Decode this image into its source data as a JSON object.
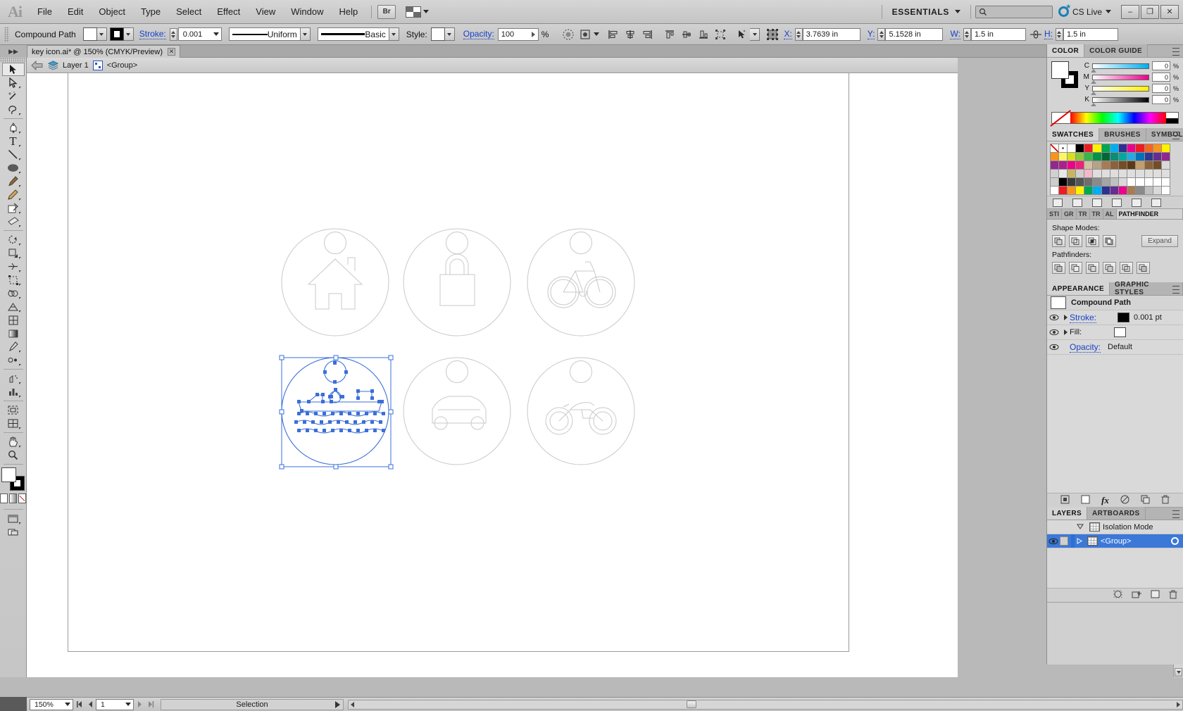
{
  "app": {
    "name": "Adobe Illustrator",
    "logo": "Ai"
  },
  "menubar": {
    "items": [
      "File",
      "Edit",
      "Object",
      "Type",
      "Select",
      "Effect",
      "View",
      "Window",
      "Help"
    ],
    "bridge_label": "Br",
    "workspace": "ESSENTIALS",
    "search_placeholder": "",
    "cslive": "CS Live",
    "window_buttons": [
      "–",
      "❐",
      "✕"
    ]
  },
  "controlbar": {
    "object_label": "Compound Path",
    "stroke_label": "Stroke:",
    "stroke_weight": "0.001",
    "profile": "Uniform",
    "brush": "Basic",
    "style_label": "Style:",
    "opacity_label": "Opacity:",
    "opacity_value": "100",
    "percent": "%",
    "x_label": "X:",
    "x_value": "3.7639 in",
    "y_label": "Y:",
    "y_value": "5.1528 in",
    "w_label": "W:",
    "w_value": "1.5 in",
    "h_label": "H:",
    "h_value": "1.5 in"
  },
  "document": {
    "tab_title": "key icon.ai* @ 150% (CMYK/Preview)",
    "breadcrumb_layer": "Layer 1",
    "breadcrumb_group": "<Group>"
  },
  "toolbar": {
    "tools": [
      "selection-tool",
      "direct-selection-tool",
      "magic-wand-tool",
      "lasso-tool",
      "pen-tool",
      "type-tool",
      "line-segment-tool",
      "ellipse-tool",
      "paintbrush-tool",
      "pencil-tool",
      "blob-brush-tool",
      "eraser-tool",
      "rotate-tool",
      "scale-tool",
      "width-tool",
      "free-transform-tool",
      "shape-builder-tool",
      "perspective-grid-tool",
      "mesh-tool",
      "gradient-tool",
      "eyedropper-tool",
      "blend-tool",
      "symbol-sprayer-tool",
      "column-graph-tool",
      "artboard-tool",
      "slice-tool",
      "hand-tool",
      "zoom-tool"
    ]
  },
  "panels": {
    "color": {
      "tabs": [
        "COLOR",
        "COLOR GUIDE"
      ],
      "active_tab": "COLOR",
      "channels": [
        {
          "label": "C",
          "value": "0",
          "unit": "%"
        },
        {
          "label": "M",
          "value": "0",
          "unit": "%"
        },
        {
          "label": "Y",
          "value": "0",
          "unit": "%"
        },
        {
          "label": "K",
          "value": "0",
          "unit": "%"
        }
      ]
    },
    "swatches": {
      "tabs": [
        "SWATCHES",
        "BRUSHES",
        "SYMBOLS"
      ],
      "active_tab": "SWATCHES",
      "rows": [
        [
          "#ffffff",
          "#ffffff",
          "#ffffff",
          "#000000",
          "#ed1c24",
          "#fff200",
          "#00a651",
          "#00aeef",
          "#2e3192",
          "#ec008c",
          "#ed1c24",
          "#f26522",
          "#f7941e",
          "#fff200"
        ],
        [
          "#f7941e",
          "#fff568",
          "#d7df23",
          "#8dc63f",
          "#39b54a",
          "#009444",
          "#006838",
          "#0d8b78",
          "#00a99d",
          "#27aae1",
          "#0072bc",
          "#2b3990",
          "#662d91",
          "#92278f"
        ],
        [
          "#92278f",
          "#a9218e",
          "#ec008c",
          "#ed207b",
          "#d1c0a5",
          "#b5a287",
          "#a67c52",
          "#8c6239",
          "#754c24",
          "#603913",
          "#c69c6d",
          "#8c6239",
          "#754c24",
          "#d9d9d9"
        ],
        [
          "#d0d0d0",
          "#e8e8e8",
          "#c8b560",
          "#cfcfcf",
          "#f3b9c8",
          "#dedede",
          "#dedede",
          "#dedede",
          "#dedede",
          "#dedede",
          "#dedede",
          "#dedede",
          "#dedede",
          "#dedede"
        ],
        [
          "#cdcdcd",
          "#000000",
          "#3a3a3a",
          "#555555",
          "#6e6e6e",
          "#8a8a8a",
          "#a5a5a5",
          "#c0c0c0",
          "#d9d9d9",
          "#ffffff",
          "#ffffff",
          "#ffffff",
          "#ffffff",
          "#ffffff"
        ],
        [
          "#ffffff",
          "#ed1c24",
          "#f7941e",
          "#fff200",
          "#00a651",
          "#00aeef",
          "#2e3192",
          "#662d91",
          "#ec008c",
          "#a67c52",
          "#8a8a8a",
          "#c0c0c0",
          "#d9d9d9",
          "#ffffff"
        ]
      ]
    },
    "pathfinder": {
      "mini_tabs": [
        "STI",
        "GR",
        "TR",
        "TR",
        "AL",
        "PATHFINDER"
      ],
      "active_tab": "PATHFINDER",
      "shape_modes_label": "Shape Modes:",
      "pathfinders_label": "Pathfinders:",
      "expand_label": "Expand",
      "shape_mode_buttons": [
        "unite",
        "minus-front",
        "intersect",
        "exclude"
      ],
      "pathfinder_buttons": [
        "divide",
        "trim",
        "merge",
        "crop",
        "outline",
        "minus-back"
      ]
    },
    "appearance": {
      "tabs": [
        "APPEARANCE",
        "GRAPHIC STYLES"
      ],
      "active_tab": "APPEARANCE",
      "object_title": "Compound Path",
      "rows": [
        {
          "name": "Stroke:",
          "value": "0.001 pt",
          "swatch": "#000000",
          "link": true
        },
        {
          "name": "Fill:",
          "value": "",
          "swatch": "#ffffff",
          "link": false
        },
        {
          "name": "Opacity:",
          "value": "Default",
          "swatch": "",
          "link": true
        }
      ]
    },
    "layers": {
      "tabs": [
        "LAYERS",
        "ARTBOARDS"
      ],
      "active_tab": "LAYERS",
      "rows": [
        {
          "name": "Isolation Mode",
          "selected": false,
          "indent": 0
        },
        {
          "name": "<Group>",
          "selected": true,
          "indent": 1
        }
      ]
    }
  },
  "statusbar": {
    "zoom": "150%",
    "page": "1",
    "status": "Selection"
  },
  "canvas": {
    "icons": [
      {
        "name": "home-icon",
        "row": 0,
        "col": 0,
        "selected": false
      },
      {
        "name": "lock-icon",
        "row": 0,
        "col": 1,
        "selected": false
      },
      {
        "name": "bicycle-icon",
        "row": 0,
        "col": 2,
        "selected": false
      },
      {
        "name": "boat-icon",
        "row": 1,
        "col": 0,
        "selected": true
      },
      {
        "name": "car-icon",
        "row": 1,
        "col": 1,
        "selected": false
      },
      {
        "name": "motorcycle-icon",
        "row": 1,
        "col": 2,
        "selected": false
      }
    ],
    "selection_color": "#3a6fd8",
    "artwork_color": "#c9c9c9"
  }
}
